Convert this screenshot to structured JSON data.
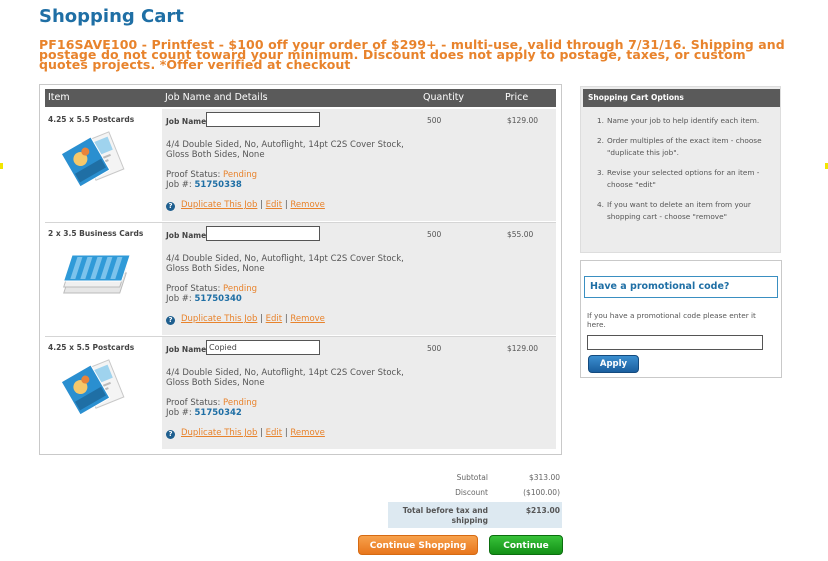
{
  "page": {
    "title": "Shopping Cart",
    "promo_banner": "PF16SAVE100 - Printfest - $100 off your order of $299+ - multi-use, valid through 7/31/16. Shipping and postage do not count toward your minimum. Discount does not apply to postage, taxes, or custom quotes projects. *Offer verified at checkout"
  },
  "cart": {
    "columns": {
      "item": "Item",
      "job": "Job Name and Details",
      "quantity": "Quantity",
      "price": "Price"
    },
    "job_name_label": "Job Name",
    "proof_label": "Proof Status:",
    "job_number_label": "Job #:",
    "actions": {
      "duplicate": "Duplicate This Job",
      "edit": "Edit",
      "remove": "Remove",
      "separator": "|"
    },
    "rows": [
      {
        "item": "4.25 x 5.5 Postcards",
        "thumbnail": "postcard-image",
        "job_name_value": "",
        "description": "4/4 Double Sided, No, Autoflight, 14pt C2S Cover Stock, Gloss Both Sides, None",
        "proof_status": "Pending",
        "job_number": "51750338",
        "quantity": "500",
        "price": "$129.00"
      },
      {
        "item": "2 x 3.5 Business Cards",
        "thumbnail": "business-card-image",
        "job_name_value": "",
        "description": "4/4 Double Sided, No, Autoflight, 14pt C2S Cover Stock, Gloss Both Sides, None",
        "proof_status": "Pending",
        "job_number": "51750340",
        "quantity": "500",
        "price": "$55.00"
      },
      {
        "item": "4.25 x 5.5 Postcards",
        "thumbnail": "postcard-image",
        "job_name_value": "Copied",
        "description": "4/4 Double Sided, No, Autoflight, 14pt C2S Cover Stock, Gloss Both Sides, None",
        "proof_status": "Pending",
        "job_number": "51750342",
        "quantity": "500",
        "price": "$129.00"
      }
    ]
  },
  "totals": {
    "subtotal_label": "Subtotal",
    "subtotal": "$313.00",
    "discount_label": "Discount",
    "discount": "($100.00)",
    "total_label": "Total before tax and shipping",
    "total": "$213.00"
  },
  "buttons": {
    "continue_shopping": "Continue Shopping",
    "continue": "Continue"
  },
  "options": {
    "title": "Shopping Cart Options",
    "items": [
      "Name your job to help identify each item.",
      "Order multiples of the exact item - choose \"duplicate this job\".",
      "Revise your selected options for an item - choose \"edit\"",
      "If you want to delete an item from your shopping cart - choose \"remove\""
    ]
  },
  "promo": {
    "title": "Have a promotional code?",
    "instructions": "If you have a promotional code please enter it here.",
    "code_value": "",
    "apply_label": "Apply"
  },
  "colors": {
    "brand_blue": "#1f6fa5",
    "accent_orange": "#e8832c",
    "header_gray": "#5a5a5a",
    "continue_green": "#139016"
  }
}
